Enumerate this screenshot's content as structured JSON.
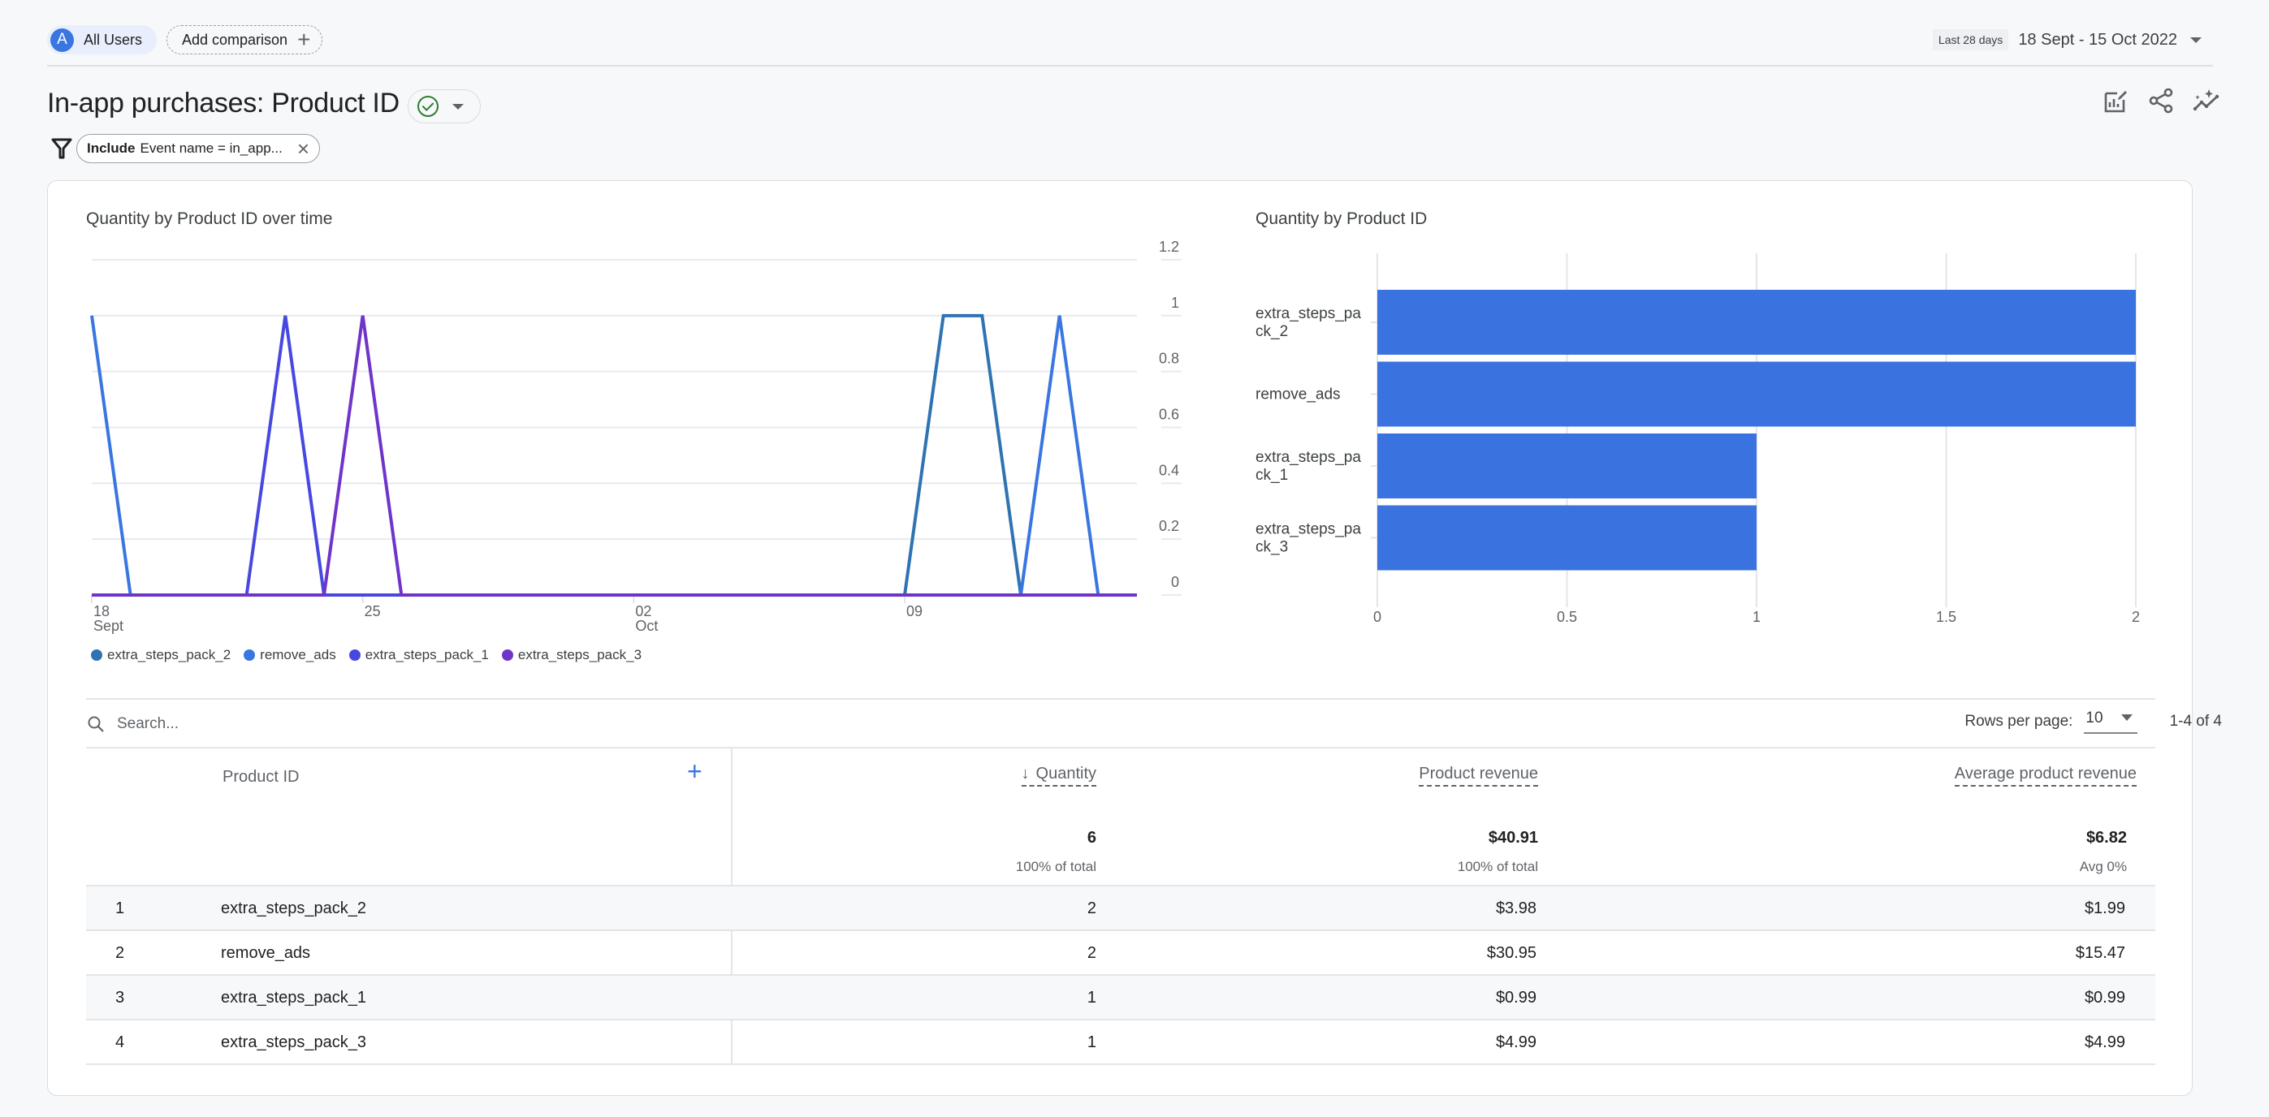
{
  "header": {
    "segment_initial": "A",
    "segment_label": "All Users",
    "add_comparison_label": "Add comparison",
    "date_badge": "Last 28 days",
    "date_range": "18 Sept - 15 Oct 2022"
  },
  "title": {
    "text": "In-app purchases: Product ID",
    "status": "check-circle-icon",
    "actions": [
      "edit-report-icon",
      "share-icon",
      "insights-icon"
    ]
  },
  "filter": {
    "keyword": "Include",
    "text": "Event name = in_app..."
  },
  "chart_data": [
    {
      "type": "line",
      "title": "Quantity by Product ID over time",
      "x": [
        "18 Sept",
        "19 Sept",
        "20 Sept",
        "21 Sept",
        "22 Sept",
        "23 Sept",
        "24 Sept",
        "25 Sept",
        "26 Sept",
        "27 Sept",
        "28 Sept",
        "29 Sept",
        "30 Sept",
        "1 Oct",
        "2 Oct",
        "3 Oct",
        "4 Oct",
        "5 Oct",
        "6 Oct",
        "7 Oct",
        "8 Oct",
        "9 Oct",
        "10 Oct",
        "11 Oct",
        "12 Oct",
        "13 Oct",
        "14 Oct",
        "15 Oct"
      ],
      "x_tick_labels": [
        {
          "index": 0,
          "day": "18",
          "month": "Sept"
        },
        {
          "index": 7,
          "day": "25",
          "month": ""
        },
        {
          "index": 14,
          "day": "02",
          "month": "Oct"
        },
        {
          "index": 21,
          "day": "09",
          "month": ""
        }
      ],
      "y_ticks": [
        "0",
        "0.2",
        "0.4",
        "0.6",
        "0.8",
        "1",
        "1.2"
      ],
      "ylim": [
        0,
        1.2
      ],
      "ylabel": "",
      "xlabel": "",
      "grid": true,
      "legend_position": "bottom-left",
      "series": [
        {
          "name": "extra_steps_pack_2",
          "color": "#2f73b3",
          "values": [
            0,
            0,
            0,
            0,
            0,
            0,
            0,
            0,
            0,
            0,
            0,
            0,
            0,
            0,
            0,
            0,
            0,
            0,
            0,
            0,
            0,
            0,
            1,
            1,
            0,
            0,
            0,
            0
          ]
        },
        {
          "name": "remove_ads",
          "color": "#3a76e0",
          "values": [
            1,
            0,
            0,
            0,
            0,
            0,
            0,
            0,
            0,
            0,
            0,
            0,
            0,
            0,
            0,
            0,
            0,
            0,
            0,
            0,
            0,
            0,
            0,
            0,
            0,
            1,
            0,
            0
          ]
        },
        {
          "name": "extra_steps_pack_1",
          "color": "#4748e0",
          "values": [
            0,
            0,
            0,
            0,
            0,
            1,
            0,
            0,
            0,
            0,
            0,
            0,
            0,
            0,
            0,
            0,
            0,
            0,
            0,
            0,
            0,
            0,
            0,
            0,
            0,
            0,
            0,
            0
          ]
        },
        {
          "name": "extra_steps_pack_3",
          "color": "#7034c9",
          "values": [
            0,
            0,
            0,
            0,
            0,
            0,
            0,
            1,
            0,
            0,
            0,
            0,
            0,
            0,
            0,
            0,
            0,
            0,
            0,
            0,
            0,
            0,
            0,
            0,
            0,
            0,
            0,
            0
          ]
        }
      ]
    },
    {
      "type": "bar",
      "orientation": "horizontal",
      "title": "Quantity by Product ID",
      "categories": [
        [
          "extra_steps_pa",
          "ck_2"
        ],
        [
          "remove_ads"
        ],
        [
          "extra_steps_pa",
          "ck_1"
        ],
        [
          "extra_steps_pa",
          "ck_3"
        ]
      ],
      "category_names": [
        "extra_steps_pack_2",
        "remove_ads",
        "extra_steps_pack_1",
        "extra_steps_pack_3"
      ],
      "values": [
        2,
        2,
        1,
        1
      ],
      "x_ticks": [
        "0",
        "0.5",
        "1",
        "1.5",
        "2"
      ],
      "xlim": [
        0,
        2
      ],
      "grid": true,
      "color": "#3a73e0",
      "xlabel": "",
      "ylabel": ""
    }
  ],
  "table": {
    "search_placeholder": "Search...",
    "rows_per_page_label": "Rows per page:",
    "rows_per_page_value": "10",
    "page_count": "1-4 of 4",
    "columns": {
      "dimension": "Product ID",
      "quantity": "Quantity",
      "revenue": "Product revenue",
      "avg_revenue": "Average product revenue"
    },
    "sort_indicator": "↓",
    "totals": {
      "quantity": "6",
      "quantity_sub": "100% of total",
      "revenue": "$40.91",
      "revenue_sub": "100% of total",
      "avg_revenue": "$6.82",
      "avg_revenue_sub": "Avg 0%"
    },
    "rows": [
      {
        "index": "1",
        "product_id": "extra_steps_pack_2",
        "quantity": "2",
        "revenue": "$3.98",
        "avg_revenue": "$1.99"
      },
      {
        "index": "2",
        "product_id": "remove_ads",
        "quantity": "2",
        "revenue": "$30.95",
        "avg_revenue": "$15.47"
      },
      {
        "index": "3",
        "product_id": "extra_steps_pack_1",
        "quantity": "1",
        "revenue": "$0.99",
        "avg_revenue": "$0.99"
      },
      {
        "index": "4",
        "product_id": "extra_steps_pack_3",
        "quantity": "1",
        "revenue": "$4.99",
        "avg_revenue": "$4.99"
      }
    ]
  }
}
